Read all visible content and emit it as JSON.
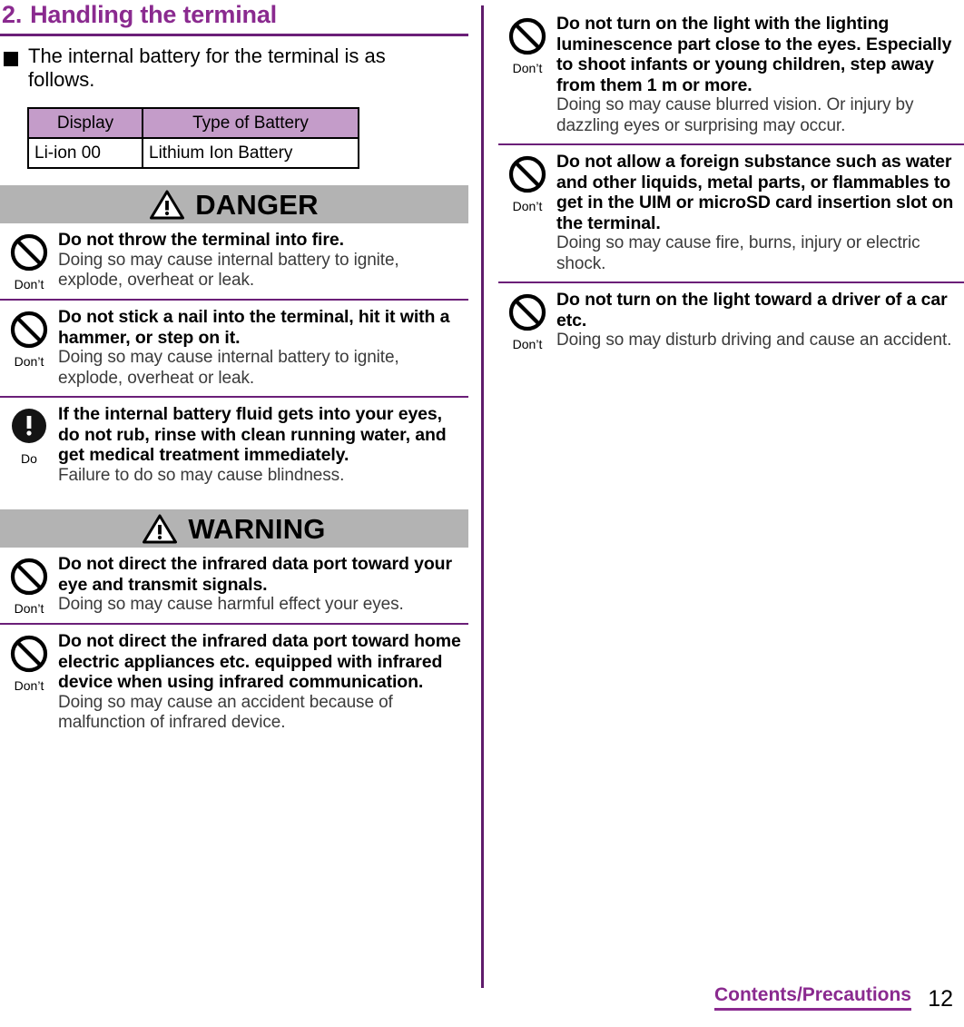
{
  "section": {
    "number": "2.",
    "title": "Handling the terminal",
    "bullet": "The internal battery for the terminal is as follows."
  },
  "battery_table": {
    "headers": [
      "Display",
      "Type of Battery"
    ],
    "rows": [
      [
        "Li-ion 00",
        "Lithium Ion Battery"
      ]
    ]
  },
  "banners": {
    "danger": "DANGER",
    "warning": "WARNING"
  },
  "icons": {
    "dont": {
      "name": "dont-icon",
      "caption": "Don’t"
    },
    "do": {
      "name": "do-icon",
      "caption": "Do"
    },
    "warning_triangle": "warning-triangle-icon",
    "bullet_square": "square-bullet-icon"
  },
  "colors": {
    "heading_purple": "#8a2a8f",
    "rule_purple": "#6b1f78",
    "table_header_fill": "#c49cc9",
    "banner_gray": "#b3b3b3",
    "body_text": "#000000",
    "sub_text": "#3b3b3b"
  },
  "left_column": {
    "danger_entries": [
      {
        "icon": "dont",
        "heading": "Do not throw the terminal into fire.",
        "sub": "Doing so may cause internal battery to ignite, explode, overheat or leak."
      },
      {
        "icon": "dont",
        "heading": "Do not stick a nail into the terminal, hit it with a hammer, or step on it.",
        "sub": "Doing so may cause internal battery to ignite, explode, overheat or leak."
      },
      {
        "icon": "do",
        "heading": "If the internal battery fluid gets into your eyes, do not rub, rinse with clean running water, and get medical treatment immediately.",
        "sub": "Failure to do so may cause blindness."
      }
    ],
    "warning_entries": [
      {
        "icon": "dont",
        "heading": "Do not direct the infrared data port toward your eye and transmit signals.",
        "sub": "Doing so may cause harmful effect your eyes."
      },
      {
        "icon": "dont",
        "heading": "Do not direct the infrared data port toward home electric appliances etc. equipped with infrared device when using infrared communication.",
        "sub": "Doing so may cause an accident because of malfunction of infrared device."
      }
    ]
  },
  "right_column": {
    "entries": [
      {
        "icon": "dont",
        "heading": "Do not turn on the light with the lighting luminescence part close to the eyes. Especially to shoot infants or young children, step away from them 1 m or more.",
        "sub": "Doing so may cause blurred vision. Or injury by dazzling eyes or surprising may occur."
      },
      {
        "icon": "dont",
        "heading": "Do not allow a foreign substance such as water and other liquids, metal parts, or flammables to get in the UIM or microSD card insertion slot on the terminal.",
        "sub": "Doing so may cause fire, burns, injury or electric shock."
      },
      {
        "icon": "dont",
        "heading": "Do not turn on the light toward a driver of a car etc.",
        "sub": "Doing so may disturb driving and cause an accident."
      }
    ]
  },
  "footer": {
    "tab_label": "Contents/Precautions",
    "page_number": "12"
  }
}
